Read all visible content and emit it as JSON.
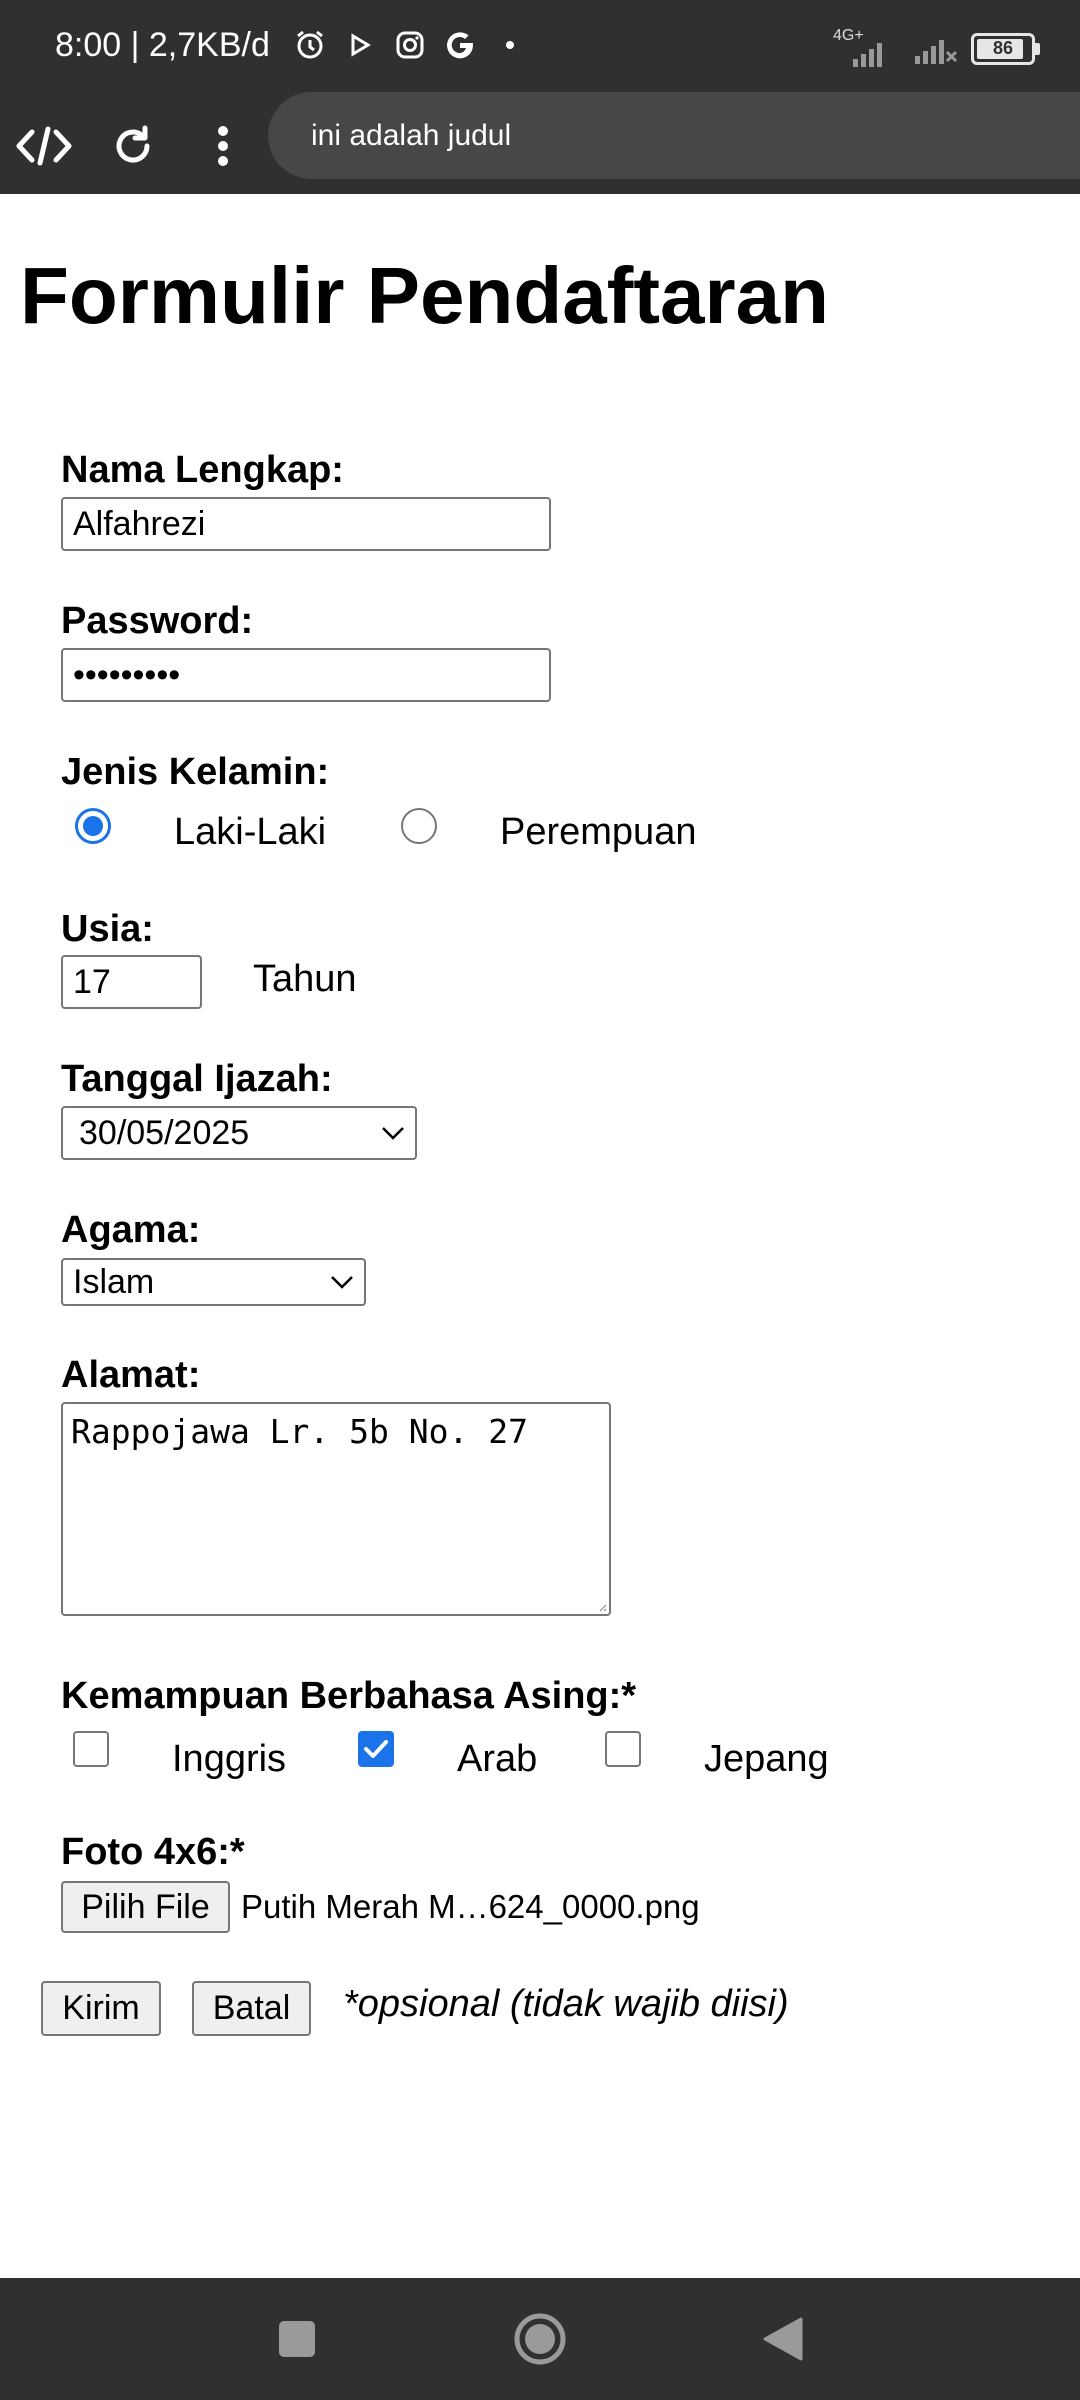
{
  "status": {
    "time": "8:00 | 2,7KB/d",
    "network_type": "4G+",
    "battery": "86",
    "icons": [
      "alarm-icon",
      "play-icon",
      "instagram-icon",
      "google-icon",
      "dot-icon",
      "signal-icon",
      "battery-icon"
    ]
  },
  "toolbar": {
    "icons": [
      "code-icon",
      "reload-icon",
      "more-vert-icon"
    ],
    "url_text": "ini adalah judul"
  },
  "form": {
    "title": "Formulir Pendaftaran",
    "name": {
      "label": "Nama Lengkap:",
      "value": "Alfahrezi"
    },
    "password": {
      "label": "Password:",
      "value": "•••••••••"
    },
    "gender": {
      "label": "Jenis Kelamin:",
      "options": [
        {
          "label": "Laki-Laki",
          "checked": true
        },
        {
          "label": "Perempuan",
          "checked": false
        }
      ]
    },
    "age": {
      "label": "Usia:",
      "value": "17",
      "unit": "Tahun"
    },
    "date": {
      "label": "Tanggal Ijazah:",
      "value": "30/05/2025"
    },
    "religion": {
      "label": "Agama:",
      "value": "Islam"
    },
    "address": {
      "label": "Alamat:",
      "value": "Rappojawa Lr. 5b No. 27"
    },
    "languages": {
      "label": "Kemampuan Berbahasa Asing:*",
      "options": [
        {
          "label": "Inggris",
          "checked": false
        },
        {
          "label": "Arab",
          "checked": true
        },
        {
          "label": "Jepang",
          "checked": false
        }
      ]
    },
    "photo": {
      "label": "Foto 4x6:*",
      "button": "Pilih File",
      "filename": "Putih Merah M…624_0000.png"
    },
    "submit_label": "Kirim",
    "cancel_label": "Batal",
    "note": "*opsional (tidak wajib diisi)"
  },
  "colors": {
    "bar_bg": "#303030",
    "url_bg": "#474747",
    "accent": "#1a73e8"
  }
}
